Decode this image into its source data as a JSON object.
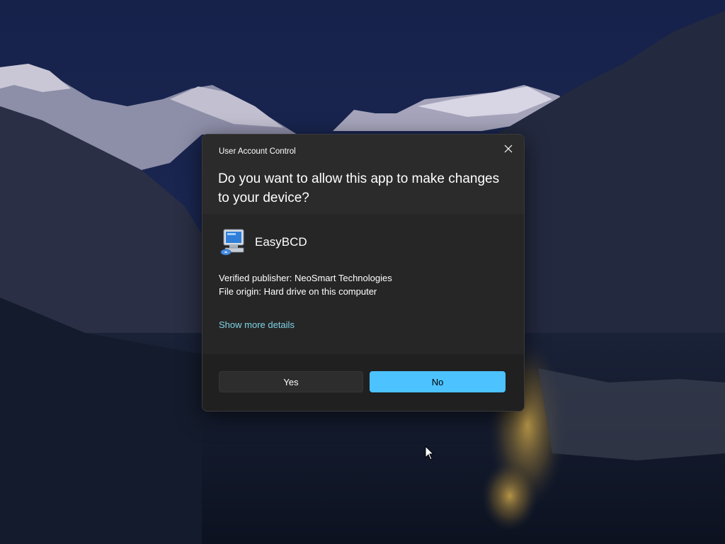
{
  "dialog": {
    "caption": "User Account Control",
    "question": "Do you want to allow this app to make changes to your device?",
    "close_icon": "close-icon",
    "app": {
      "name": "EasyBCD",
      "icon": "computer-app-icon"
    },
    "publisher": "Verified publisher: NeoSmart Technologies",
    "origin": "File origin: Hard drive on this computer",
    "details_link": "Show more details",
    "buttons": {
      "yes": "Yes",
      "no": "No"
    }
  },
  "colors": {
    "accent": "#4cc2ff",
    "link": "#7fd3e6",
    "dialog_bg": "#2b2b2b",
    "footer_bg": "#202020"
  }
}
